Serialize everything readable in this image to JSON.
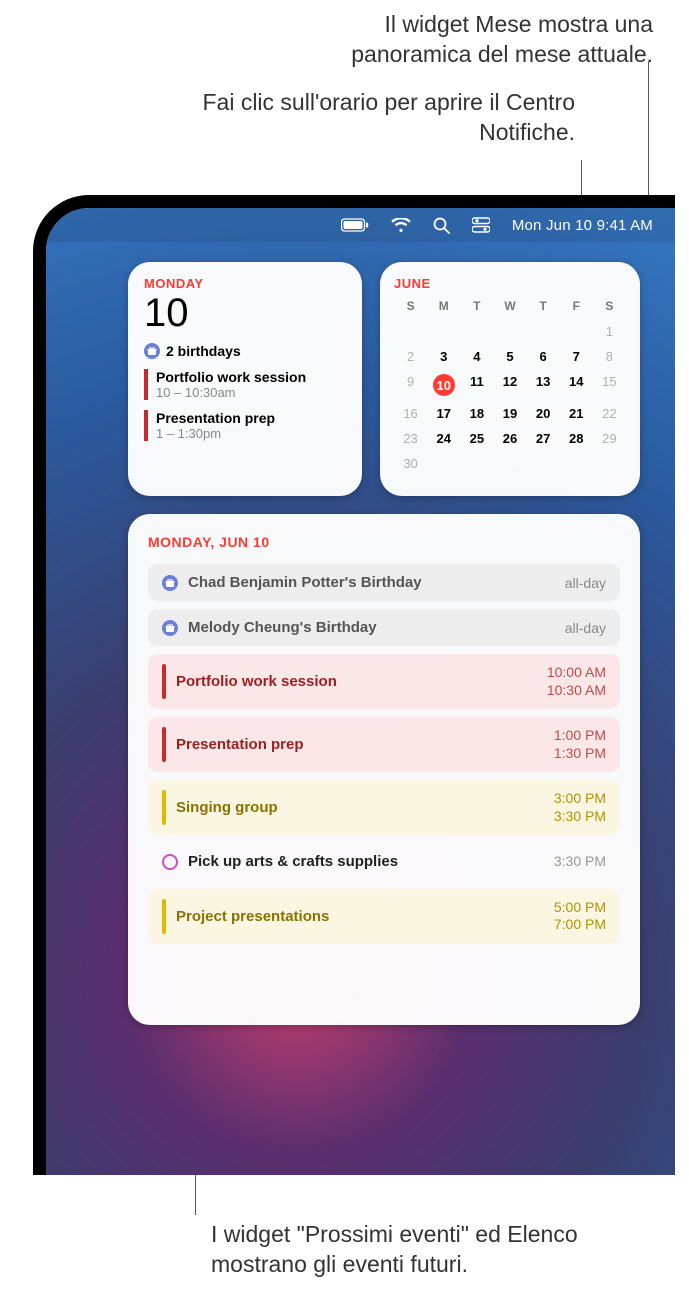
{
  "annotations": {
    "top1": "Il widget Mese mostra una panoramica del mese attuale.",
    "top2": "Fai clic sull'orario per aprire il Centro Notifiche.",
    "bottom": "I widget \"Prossimi eventi\" ed Elenco mostrano gli eventi futuri."
  },
  "menubar": {
    "clock": "Mon Jun 10  9:41 AM"
  },
  "today_widget": {
    "day_label": "MONDAY",
    "day_number": "10",
    "birthdays_label": "2 birthdays",
    "events": [
      {
        "title": "Portfolio work session",
        "time": "10 – 10:30AM"
      },
      {
        "title": "Presentation prep",
        "time": "1 – 1:30PM"
      }
    ]
  },
  "month_widget": {
    "title": "JUNE",
    "dow": [
      "S",
      "M",
      "T",
      "W",
      "T",
      "F",
      "S"
    ],
    "weeks": [
      [
        {
          "n": "",
          "dim": true
        },
        {
          "n": "",
          "dim": true
        },
        {
          "n": "",
          "dim": true
        },
        {
          "n": "",
          "dim": true
        },
        {
          "n": "",
          "dim": true
        },
        {
          "n": "",
          "dim": true
        },
        {
          "n": "1",
          "dim": true
        }
      ],
      [
        {
          "n": "2",
          "dim": true
        },
        {
          "n": "3"
        },
        {
          "n": "4"
        },
        {
          "n": "5"
        },
        {
          "n": "6"
        },
        {
          "n": "7"
        },
        {
          "n": "8",
          "dim": true
        }
      ],
      [
        {
          "n": "9",
          "dim": true
        },
        {
          "n": "10",
          "sel": true
        },
        {
          "n": "11"
        },
        {
          "n": "12"
        },
        {
          "n": "13"
        },
        {
          "n": "14"
        },
        {
          "n": "15",
          "dim": true
        }
      ],
      [
        {
          "n": "16",
          "dim": true
        },
        {
          "n": "17"
        },
        {
          "n": "18"
        },
        {
          "n": "19"
        },
        {
          "n": "20"
        },
        {
          "n": "21"
        },
        {
          "n": "22",
          "dim": true
        }
      ],
      [
        {
          "n": "23",
          "dim": true
        },
        {
          "n": "24"
        },
        {
          "n": "25"
        },
        {
          "n": "26"
        },
        {
          "n": "27"
        },
        {
          "n": "28"
        },
        {
          "n": "29",
          "dim": true
        }
      ],
      [
        {
          "n": "30",
          "dim": true
        },
        {
          "n": ""
        },
        {
          "n": ""
        },
        {
          "n": ""
        },
        {
          "n": ""
        },
        {
          "n": ""
        },
        {
          "n": ""
        }
      ]
    ]
  },
  "upcoming": {
    "title": "MONDAY, JUN 10",
    "events": [
      {
        "kind": "birthday",
        "title": "Chad Benjamin Potter's Birthday",
        "allday": "all-day"
      },
      {
        "kind": "birthday",
        "title": "Melody Cheung's Birthday",
        "allday": "all-day"
      },
      {
        "kind": "red",
        "title": "Portfolio work session",
        "start": "10:00 AM",
        "end": "10:30 AM"
      },
      {
        "kind": "red",
        "title": "Presentation prep",
        "start": "1:00 PM",
        "end": "1:30 PM"
      },
      {
        "kind": "yellow",
        "title": "Singing group",
        "start": "3:00 PM",
        "end": "3:30 PM"
      },
      {
        "kind": "reminder",
        "title": "Pick up arts & crafts supplies",
        "start": "3:30 PM"
      },
      {
        "kind": "yellow",
        "title": "Project presentations",
        "start": "5:00 PM",
        "end": "7:00 PM"
      }
    ]
  }
}
